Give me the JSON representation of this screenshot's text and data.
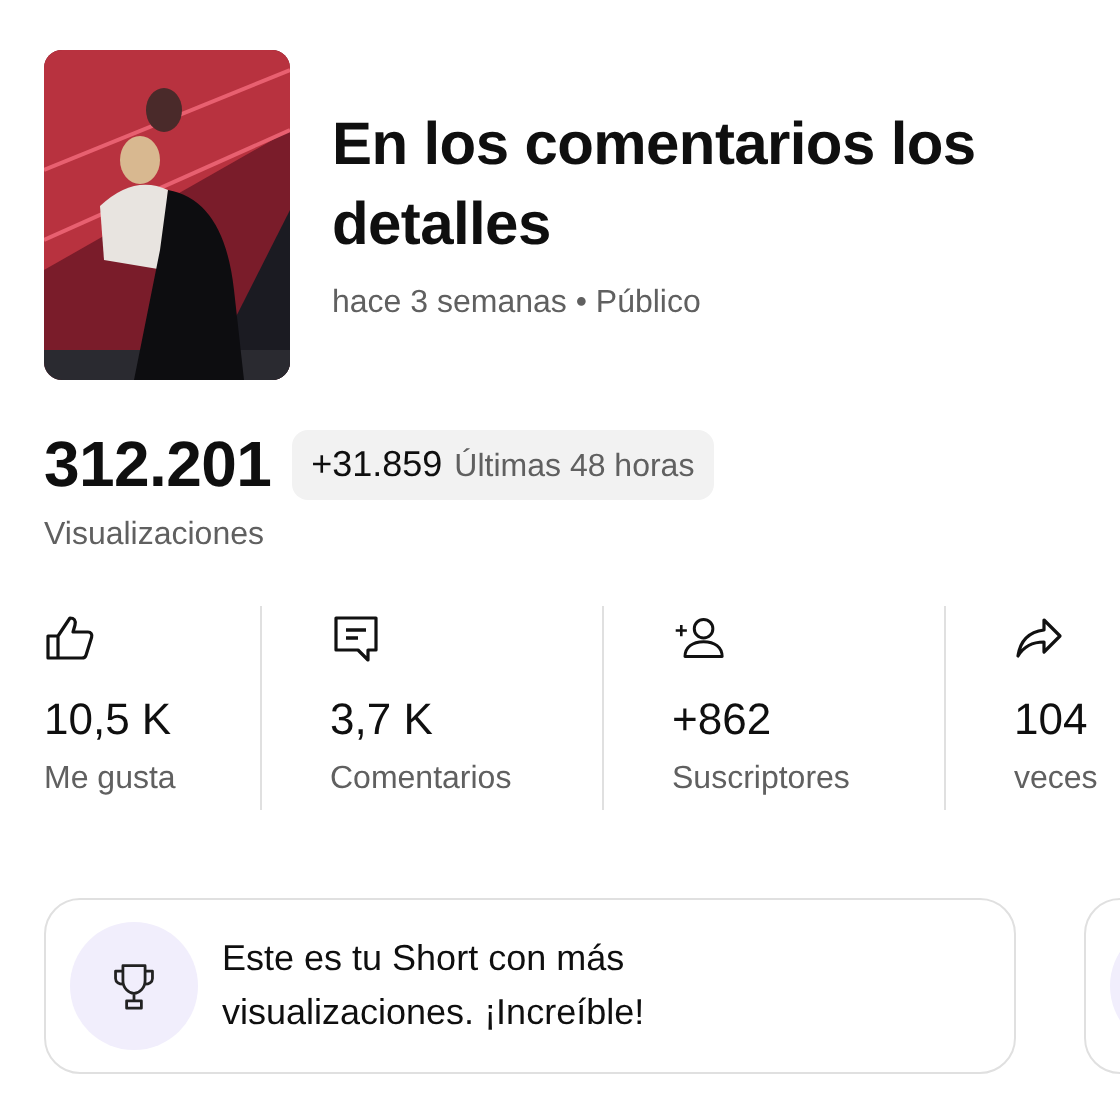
{
  "video": {
    "kind": "picture",
    "title": "En los comentarios los detalles",
    "meta": "hace 3 semanas • Público"
  },
  "views": {
    "value": "312.201",
    "label": "Visualizaciones",
    "delta": "+31.859",
    "period": "Últimas 48 horas"
  },
  "stats": [
    {
      "kind": "like",
      "value": "10,5 K",
      "label": "Me gusta"
    },
    {
      "kind": "comment",
      "value": "3,7 K",
      "label": "Comentarios"
    },
    {
      "kind": "subscriber",
      "value": "+862",
      "label": "Suscriptores"
    },
    {
      "kind": "share",
      "value": "104",
      "label": "veces"
    }
  ],
  "cards": [
    {
      "kind": "trophy",
      "text": "Este es tu Short con más visualizaciones. ¡Increíble!"
    }
  ]
}
